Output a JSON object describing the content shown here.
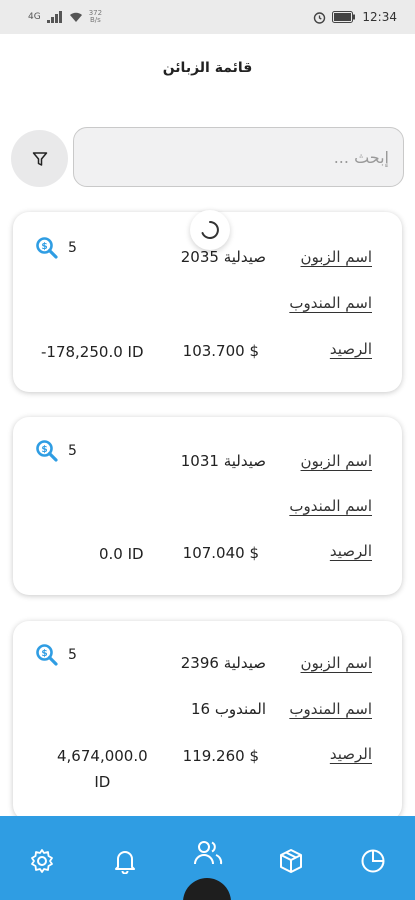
{
  "status_bar": {
    "network": "4G",
    "speed_value": "372",
    "speed_unit": "B/s",
    "time": "12:34"
  },
  "header": {
    "title": "قائمة الزبائن"
  },
  "search": {
    "placeholder": "إبحث ..."
  },
  "labels": {
    "customer_name": "اسم الزبون",
    "rep_name": "اسم المندوب",
    "balance": "الرصيد"
  },
  "customers": [
    {
      "name": "صيدلية 2035",
      "rep": "",
      "balance_usd": "103.700 $",
      "balance_iqd": "-178,250.0 ID",
      "count": "5"
    },
    {
      "name": "صيدلية 1031",
      "rep": "",
      "balance_usd": "107.040 $",
      "balance_iqd": "0.0 ID",
      "count": "5"
    },
    {
      "name": "صيدلية 2396",
      "rep": "المندوب 16",
      "balance_usd": "119.260 $",
      "balance_iqd_line1": "4,674,000.0",
      "balance_iqd_line2": "ID",
      "count": "5"
    }
  ],
  "nav": {
    "items": [
      "settings-icon",
      "bell-icon",
      "users-icon",
      "box-icon",
      "pie-chart-icon"
    ],
    "active": "users-icon",
    "colors": {
      "bar": "#2f9de3",
      "icon": "#ffffff"
    }
  },
  "colors": {
    "accent": "#2f9de3",
    "search_icon": "#2f9de3"
  }
}
